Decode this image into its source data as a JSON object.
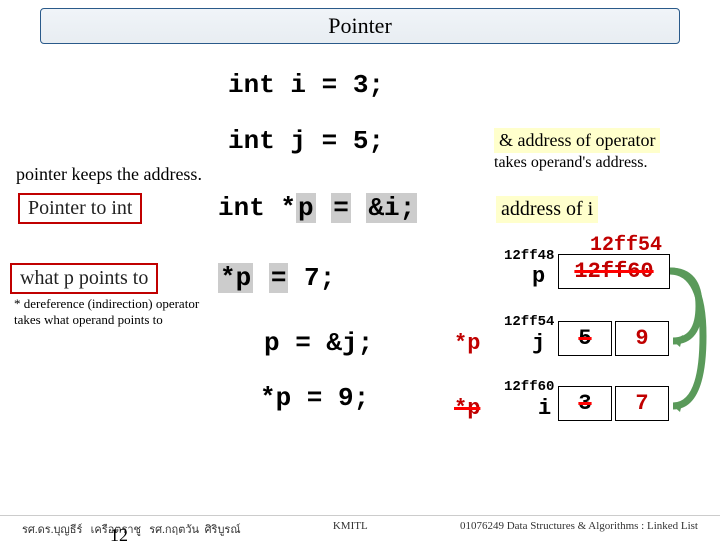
{
  "title": "Pointer",
  "code": {
    "l1": "int i = 3;",
    "l2": "int j = 5;",
    "l3": "int *p = &i;",
    "l4": "*p = 7;",
    "l5": "p = &j;",
    "l6": "*p = 9;"
  },
  "hints": {
    "keeps": "pointer keeps the address.",
    "ptrto": "Pointer to int",
    "what": "what p points to",
    "deref": "* dereference (indirection) operator  takes what operand points to",
    "amp": "& address of operator",
    "takes": "takes operand's address.",
    "addrof": "address of i"
  },
  "mem": {
    "p_addr": "12ff48",
    "p_var": "p",
    "p_val_old": "12ff60",
    "p_val_lbl": "12ff54",
    "j_addr": "12ff54",
    "j_var": "j",
    "j_val_old": "5",
    "j_val_new": "9",
    "i_addr": "12ff60",
    "i_var": "i",
    "i_val_old": "3",
    "i_val_new": "7",
    "starp": "*p"
  },
  "footer": {
    "a": "รศ.ดร.บุญธีร์",
    "b": "เครือตราชู",
    "c": "รศ.กฤตวัน",
    "d": "ศิริบูรณ์",
    "mid": "KMITL",
    "right": "01076249 Data Structures & Algorithms : Linked List",
    "page": "12"
  }
}
